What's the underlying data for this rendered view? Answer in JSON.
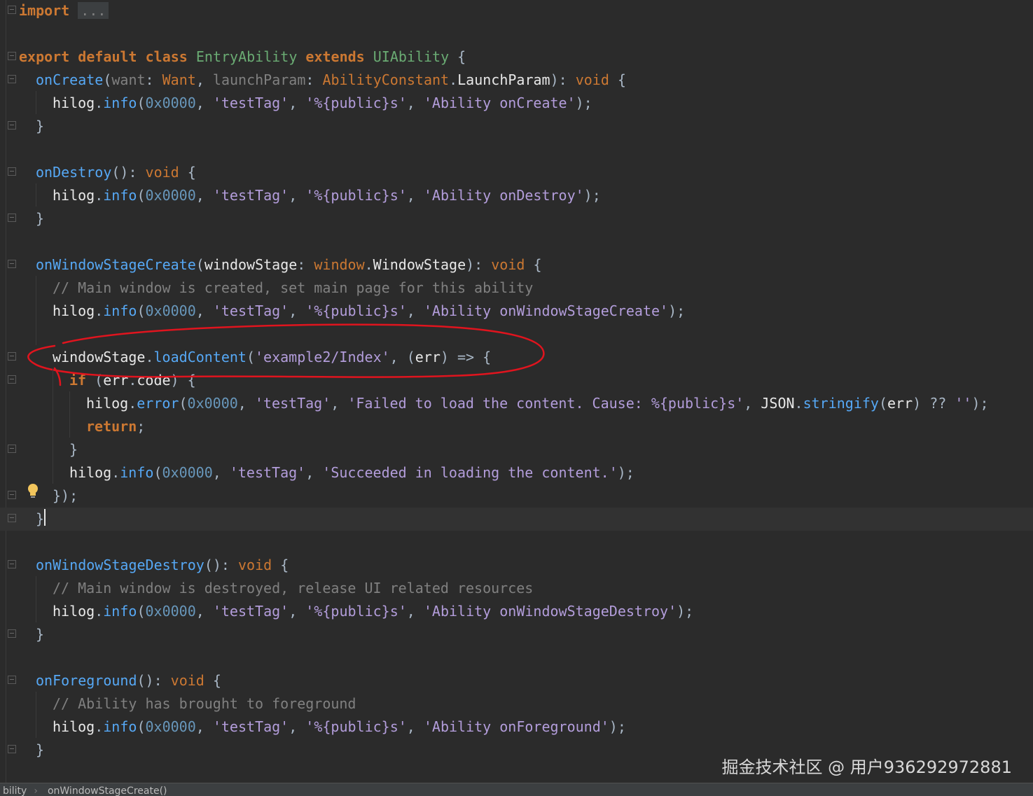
{
  "editor": {
    "lines": [
      {
        "segments": [
          [
            "kw",
            "import"
          ],
          [
            "punc",
            " "
          ],
          [
            "collapsed",
            "..."
          ]
        ]
      },
      {
        "segments": []
      },
      {
        "segments": [
          [
            "kw",
            "export default class "
          ],
          [
            "cls",
            "EntryAbility"
          ],
          [
            "kw",
            " extends "
          ],
          [
            "cls",
            "UIAbility"
          ],
          [
            "punc",
            " {"
          ]
        ]
      },
      {
        "segments": [
          [
            "fn",
            "onCreate"
          ],
          [
            "punc",
            "("
          ],
          [
            "param",
            "want"
          ],
          [
            "punc",
            ": "
          ],
          [
            "type",
            "Want"
          ],
          [
            "punc",
            ", "
          ],
          [
            "param",
            "launchParam"
          ],
          [
            "punc",
            ": "
          ],
          [
            "type",
            "AbilityConstant"
          ],
          [
            "punc",
            "."
          ],
          [
            "id",
            "LaunchParam"
          ],
          [
            "punc",
            "): "
          ],
          [
            "kwn",
            "void"
          ],
          [
            "punc",
            " {"
          ]
        ]
      },
      {
        "segments": [
          [
            "id",
            "hilog"
          ],
          [
            "punc",
            "."
          ],
          [
            "fn",
            "info"
          ],
          [
            "punc",
            "("
          ],
          [
            "num",
            "0x0000"
          ],
          [
            "punc",
            ", "
          ],
          [
            "str",
            "'testTag'"
          ],
          [
            "punc",
            ", "
          ],
          [
            "str",
            "'%{public}s'"
          ],
          [
            "punc",
            ", "
          ],
          [
            "str",
            "'Ability onCreate'"
          ],
          [
            "punc",
            ");"
          ]
        ]
      },
      {
        "segments": [
          [
            "punc",
            "}"
          ]
        ]
      },
      {
        "segments": []
      },
      {
        "segments": [
          [
            "fn",
            "onDestroy"
          ],
          [
            "punc",
            "(): "
          ],
          [
            "kwn",
            "void"
          ],
          [
            "punc",
            " {"
          ]
        ]
      },
      {
        "segments": [
          [
            "id",
            "hilog"
          ],
          [
            "punc",
            "."
          ],
          [
            "fn",
            "info"
          ],
          [
            "punc",
            "("
          ],
          [
            "num",
            "0x0000"
          ],
          [
            "punc",
            ", "
          ],
          [
            "str",
            "'testTag'"
          ],
          [
            "punc",
            ", "
          ],
          [
            "str",
            "'%{public}s'"
          ],
          [
            "punc",
            ", "
          ],
          [
            "str",
            "'Ability onDestroy'"
          ],
          [
            "punc",
            ");"
          ]
        ]
      },
      {
        "segments": [
          [
            "punc",
            "}"
          ]
        ]
      },
      {
        "segments": []
      },
      {
        "segments": [
          [
            "fn",
            "onWindowStageCreate"
          ],
          [
            "punc",
            "("
          ],
          [
            "id",
            "windowStage"
          ],
          [
            "punc",
            ": "
          ],
          [
            "type",
            "window"
          ],
          [
            "punc",
            "."
          ],
          [
            "id",
            "WindowStage"
          ],
          [
            "punc",
            "): "
          ],
          [
            "kwn",
            "void"
          ],
          [
            "punc",
            " {"
          ]
        ]
      },
      {
        "segments": [
          [
            "cmt",
            "// Main window is created, set main page for this ability"
          ]
        ]
      },
      {
        "segments": [
          [
            "id",
            "hilog"
          ],
          [
            "punc",
            "."
          ],
          [
            "fn",
            "info"
          ],
          [
            "punc",
            "("
          ],
          [
            "num",
            "0x0000"
          ],
          [
            "punc",
            ", "
          ],
          [
            "str",
            "'testTag'"
          ],
          [
            "punc",
            ", "
          ],
          [
            "str",
            "'%{public}s'"
          ],
          [
            "punc",
            ", "
          ],
          [
            "str",
            "'Ability onWindowStageCreate'"
          ],
          [
            "punc",
            ");"
          ]
        ]
      },
      {
        "segments": []
      },
      {
        "segments": [
          [
            "id",
            "windowStage"
          ],
          [
            "punc",
            "."
          ],
          [
            "fn",
            "loadContent"
          ],
          [
            "punc",
            "("
          ],
          [
            "str",
            "'example2/Index'"
          ],
          [
            "punc",
            ", ("
          ],
          [
            "id",
            "err"
          ],
          [
            "punc",
            ") => {"
          ]
        ]
      },
      {
        "segments": [
          [
            "kw",
            "if"
          ],
          [
            "punc",
            " ("
          ],
          [
            "id",
            "err"
          ],
          [
            "punc",
            "."
          ],
          [
            "id",
            "code"
          ],
          [
            "punc",
            ") {"
          ]
        ]
      },
      {
        "segments": [
          [
            "id",
            "hilog"
          ],
          [
            "punc",
            "."
          ],
          [
            "fn",
            "error"
          ],
          [
            "punc",
            "("
          ],
          [
            "num",
            "0x0000"
          ],
          [
            "punc",
            ", "
          ],
          [
            "str",
            "'testTag'"
          ],
          [
            "punc",
            ", "
          ],
          [
            "str",
            "'Failed to load the content. Cause: %{public}s'"
          ],
          [
            "punc",
            ", "
          ],
          [
            "id",
            "JSON"
          ],
          [
            "punc",
            "."
          ],
          [
            "fn",
            "stringify"
          ],
          [
            "punc",
            "("
          ],
          [
            "id",
            "err"
          ],
          [
            "punc",
            ") ?? "
          ],
          [
            "str",
            "''"
          ],
          [
            "punc",
            ");"
          ]
        ]
      },
      {
        "segments": [
          [
            "kw",
            "return"
          ],
          [
            "punc",
            ";"
          ]
        ]
      },
      {
        "segments": [
          [
            "punc",
            "}"
          ]
        ]
      },
      {
        "segments": [
          [
            "id",
            "hilog"
          ],
          [
            "punc",
            "."
          ],
          [
            "fn",
            "info"
          ],
          [
            "punc",
            "("
          ],
          [
            "num",
            "0x0000"
          ],
          [
            "punc",
            ", "
          ],
          [
            "str",
            "'testTag'"
          ],
          [
            "punc",
            ", "
          ],
          [
            "str",
            "'Succeeded in loading the content.'"
          ],
          [
            "punc",
            ");"
          ]
        ]
      },
      {
        "segments": [
          [
            "punc",
            "});"
          ]
        ]
      },
      {
        "segments": [
          [
            "punc",
            "}"
          ]
        ]
      },
      {
        "segments": []
      },
      {
        "segments": [
          [
            "fn",
            "onWindowStageDestroy"
          ],
          [
            "punc",
            "(): "
          ],
          [
            "kwn",
            "void"
          ],
          [
            "punc",
            " {"
          ]
        ]
      },
      {
        "segments": [
          [
            "cmt",
            "// Main window is destroyed, release UI related resources"
          ]
        ]
      },
      {
        "segments": [
          [
            "id",
            "hilog"
          ],
          [
            "punc",
            "."
          ],
          [
            "fn",
            "info"
          ],
          [
            "punc",
            "("
          ],
          [
            "num",
            "0x0000"
          ],
          [
            "punc",
            ", "
          ],
          [
            "str",
            "'testTag'"
          ],
          [
            "punc",
            ", "
          ],
          [
            "str",
            "'%{public}s'"
          ],
          [
            "punc",
            ", "
          ],
          [
            "str",
            "'Ability onWindowStageDestroy'"
          ],
          [
            "punc",
            ");"
          ]
        ]
      },
      {
        "segments": [
          [
            "punc",
            "}"
          ]
        ]
      },
      {
        "segments": []
      },
      {
        "segments": [
          [
            "fn",
            "onForeground"
          ],
          [
            "punc",
            "(): "
          ],
          [
            "kwn",
            "void"
          ],
          [
            "punc",
            " {"
          ]
        ]
      },
      {
        "segments": [
          [
            "cmt",
            "// Ability has brought to foreground"
          ]
        ]
      },
      {
        "segments": [
          [
            "id",
            "hilog"
          ],
          [
            "punc",
            "."
          ],
          [
            "fn",
            "info"
          ],
          [
            "punc",
            "("
          ],
          [
            "num",
            "0x0000"
          ],
          [
            "punc",
            ", "
          ],
          [
            "str",
            "'testTag'"
          ],
          [
            "punc",
            ", "
          ],
          [
            "str",
            "'%{public}s'"
          ],
          [
            "punc",
            ", "
          ],
          [
            "str",
            "'Ability onForeground'"
          ],
          [
            "punc",
            ");"
          ]
        ]
      },
      {
        "segments": [
          [
            "punc",
            "}"
          ]
        ]
      }
    ]
  },
  "watermark": "掘金技术社区 @ 用户936292972881",
  "breadcrumb": {
    "items": [
      "bility",
      "onWindowStageCreate()"
    ]
  },
  "colors": {
    "background": "#2b2b2b",
    "annotation": "#e0141e"
  }
}
